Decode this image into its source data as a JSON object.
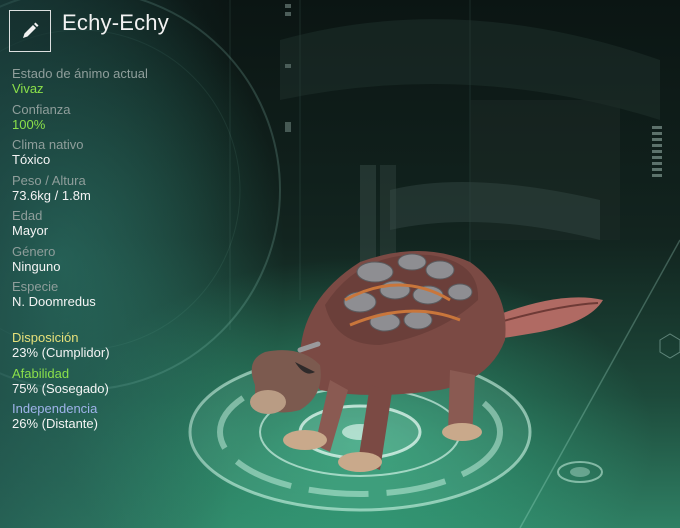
{
  "header": {
    "title": "Echy-Echy",
    "edit_icon": "pencil-icon"
  },
  "stats": [
    {
      "label": "Estado de ánimo actual",
      "value": "Vivaz",
      "value_color": "#8be04a"
    },
    {
      "label": "Confianza",
      "value": "100%",
      "value_color": "#8be04a"
    },
    {
      "label": "Clima nativo",
      "value": "Tóxico"
    },
    {
      "label": "Peso / Altura",
      "value": "73.6kg / 1.8m"
    },
    {
      "label": "Edad",
      "value": "Mayor"
    },
    {
      "label": "Género",
      "value": "Ninguno"
    },
    {
      "label": "Especie",
      "value": "N. Doomredus"
    }
  ],
  "traits": [
    {
      "label": "Disposición",
      "value": "23% (Cumplidor)",
      "label_color": "#e6e07a"
    },
    {
      "label": "Afabilidad",
      "value": "75% (Sosegado)",
      "label_color": "#8be04a"
    },
    {
      "label": "Independencia",
      "value": "26% (Distante)",
      "label_color": "#9fb3ea"
    }
  ]
}
